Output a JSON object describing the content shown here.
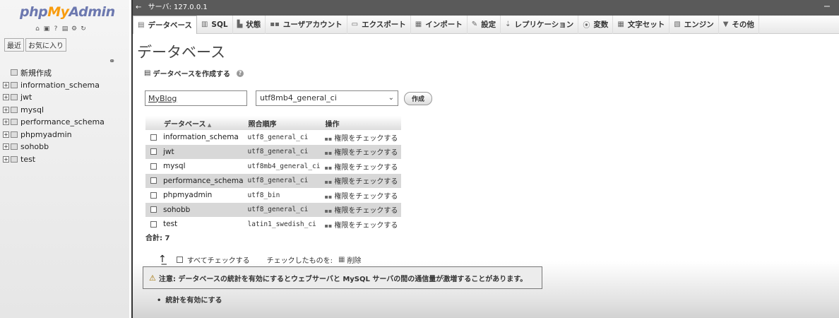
{
  "sidebar": {
    "logo_php": "php",
    "logo_my": "My",
    "logo_admin": "Admin",
    "tab_recent": "最近",
    "tab_favorites": "お気に入り",
    "new_label": "新規作成",
    "databases": [
      "information_schema",
      "jwt",
      "mysql",
      "performance_schema",
      "phpmyadmin",
      "sohobb",
      "test"
    ]
  },
  "titlebar": {
    "back": "←",
    "server": "サーバ: 127.0.0.1",
    "min": "ー"
  },
  "menu": [
    {
      "label": "データベース",
      "icon": "db-icon"
    },
    {
      "label": "SQL",
      "icon": "sql-icon"
    },
    {
      "label": "状態",
      "icon": "status-icon"
    },
    {
      "label": "ユーザアカウント",
      "icon": "users-icon"
    },
    {
      "label": "エクスポート",
      "icon": "export-icon"
    },
    {
      "label": "インポート",
      "icon": "import-icon"
    },
    {
      "label": "設定",
      "icon": "wrench-icon"
    },
    {
      "label": "レプリケーション",
      "icon": "replication-icon"
    },
    {
      "label": "変数",
      "icon": "variables-icon"
    },
    {
      "label": "文字セット",
      "icon": "charset-icon"
    },
    {
      "label": "エンジン",
      "icon": "engine-icon"
    },
    {
      "label": "その他",
      "icon": "more-icon"
    }
  ],
  "page_title": "データベース",
  "create": {
    "heading": "データベースを作成する",
    "db_name_value": "MyBlog",
    "collation_value": "utf8mb4_general_ci",
    "button_label": "作成"
  },
  "table": {
    "headers": [
      "データベース",
      "照合順序",
      "操作"
    ],
    "rows": [
      {
        "name": "information_schema",
        "collation": "utf8_general_ci",
        "action": "権限をチェックする"
      },
      {
        "name": "jwt",
        "collation": "utf8_general_ci",
        "action": "権限をチェックする"
      },
      {
        "name": "mysql",
        "collation": "utf8mb4_general_ci",
        "action": "権限をチェックする"
      },
      {
        "name": "performance_schema",
        "collation": "utf8_general_ci",
        "action": "権限をチェックする"
      },
      {
        "name": "phpmyadmin",
        "collation": "utf8_bin",
        "action": "権限をチェックする"
      },
      {
        "name": "sohobb",
        "collation": "utf8_general_ci",
        "action": "権限をチェックする"
      },
      {
        "name": "test",
        "collation": "latin1_swedish_ci",
        "action": "権限をチェックする"
      }
    ],
    "total": "合計: 7"
  },
  "footer": {
    "check_all": "すべてチェックする",
    "with_selected": "チェックしたものを:",
    "drop": "削除"
  },
  "notice": {
    "text": "注意: データベースの統計を有効にするとウェブサーバと MySQL サーバの間の通信量が激増することがあります。"
  },
  "enable_stats": "統計を有効にする"
}
